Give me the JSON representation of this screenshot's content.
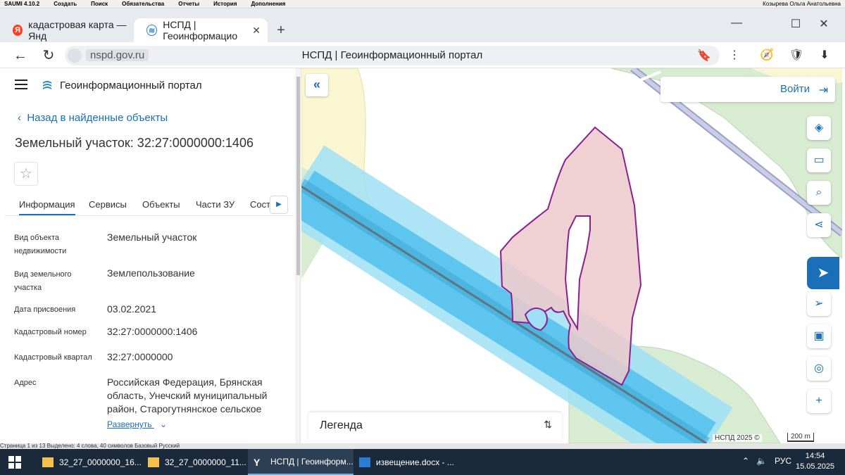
{
  "saumi": {
    "title": "SAUMI 4.10.2",
    "menu": [
      "Создать",
      "Поиск",
      "Обязательства",
      "Отчеты",
      "История",
      "Дополнения"
    ],
    "user": "Козырева Ольга Анатольевна"
  },
  "browser": {
    "tabs": [
      {
        "label": "кадастровая карта — Янд",
        "icon": "yandex-icon"
      },
      {
        "label": "НСПД | Геоинформацио",
        "icon": "nspd-icon"
      }
    ],
    "url": "nspd.gov.ru",
    "page_title": "НСПД | Геоинформационный портал"
  },
  "panel": {
    "portal_name": "Геоинформационный портал",
    "back_link": "Назад в найденные объекты",
    "object_title": "Земельный участок: 32:27:0000000:1406",
    "tabs": [
      "Информация",
      "Сервисы",
      "Объекты",
      "Части ЗУ",
      "Состав"
    ],
    "rows": [
      {
        "label": "Вид объекта недвижимости",
        "value": "Земельный участок"
      },
      {
        "label": "Вид земельного участка",
        "value": "Землепользование"
      },
      {
        "label": "Дата присвоения",
        "value": "03.02.2021"
      },
      {
        "label": "Кадастровый номер",
        "value": "32:27:0000000:1406"
      },
      {
        "label": "Кадастровый квартал",
        "value": "32:27:0000000"
      },
      {
        "label": "Адрес",
        "value": "Российская Федерация, Брянская область, Унечский муниципальный район, Старогутнянское сельское"
      }
    ],
    "expand_label": "Развернуть"
  },
  "map": {
    "login_label": "Войти",
    "legend_label": "Легенда",
    "copyright": "НСПД 2025 ©",
    "scale": "200 m",
    "colors": {
      "parcel_fill": "#ecc9cb",
      "parcel_stroke": "#8b1f8f",
      "river": "#5ec6ee",
      "forest": "#d8ecd2",
      "field": "#fbf6d2",
      "accent": "#1a6fb8"
    }
  },
  "doc_strip": "Страница 1 из 13   Выделено: 4 слова, 40 символов   Базовый   Русский",
  "taskbar": {
    "items": [
      {
        "label": "32_27_0000000_16...",
        "icon": "folder-icon"
      },
      {
        "label": "32_27_0000000_11...",
        "icon": "folder-icon"
      },
      {
        "label": "НСПД | Геоинформ...",
        "icon": "yandex-browser-icon"
      },
      {
        "label": "извещение.docx - ...",
        "icon": "word-icon"
      }
    ],
    "lang": "РУС",
    "time": "14:54",
    "date": "15.05.2025"
  }
}
